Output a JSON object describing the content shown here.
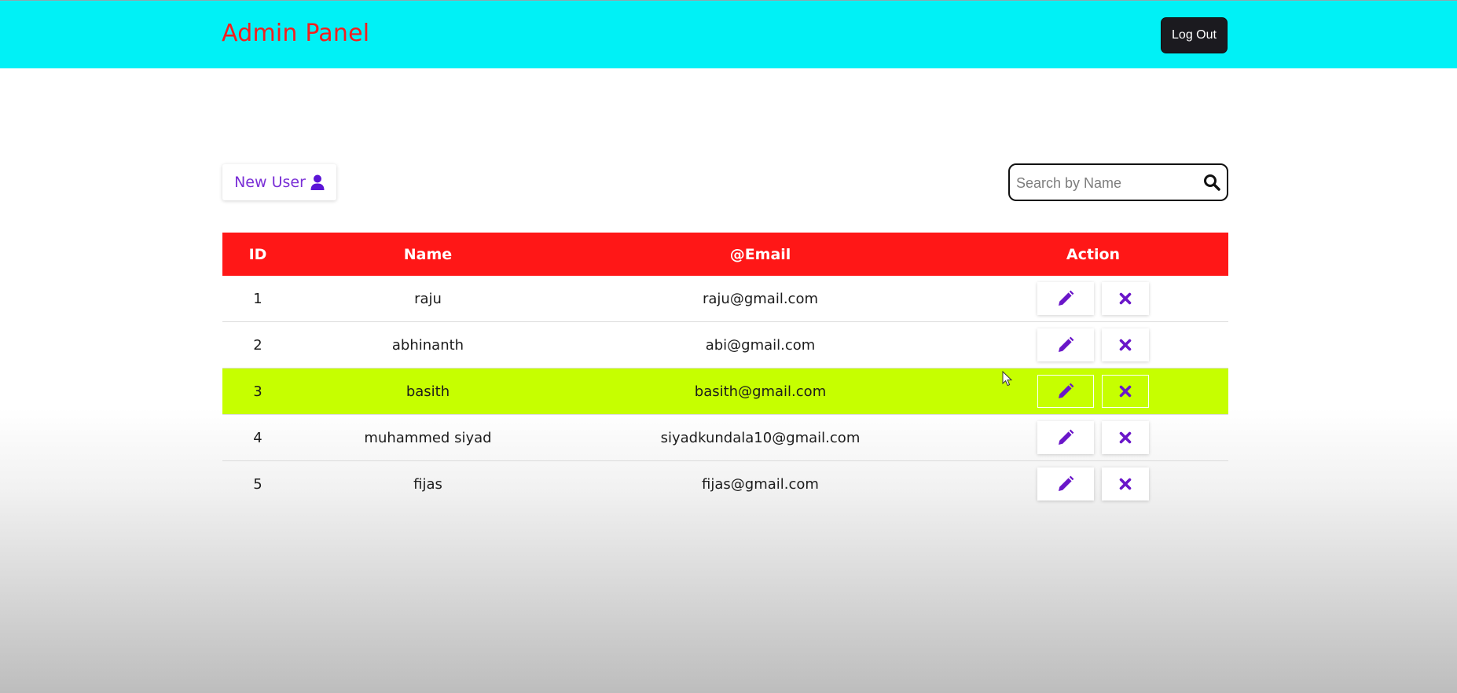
{
  "header": {
    "title": "Admin Panel",
    "logout_label": "Log Out",
    "background_color": "#00f1f6",
    "title_color": "#f71d1d"
  },
  "toolbar": {
    "new_user_label": "New User",
    "new_user_icon": "user-icon",
    "search_placeholder": "Search by Name",
    "search_value": "",
    "search_icon": "search-icon"
  },
  "table": {
    "header_color": "#ff1717",
    "highlight_color": "#c6ff00",
    "columns": [
      "ID",
      "Name",
      "@Email",
      "Action"
    ],
    "rows": [
      {
        "id": "1",
        "name": "raju",
        "email": "raju@gmail.com"
      },
      {
        "id": "2",
        "name": "abhinanth",
        "email": "abi@gmail.com"
      },
      {
        "id": "3",
        "name": "basith",
        "email": "basith@gmail.com"
      },
      {
        "id": "4",
        "name": "muhammed siyad",
        "email": "siyadkundala10@gmail.com"
      },
      {
        "id": "5",
        "name": "fijas",
        "email": "fijas@gmail.com"
      }
    ],
    "action_icons": [
      "pencil-icon",
      "close-icon"
    ],
    "icon_color": "#6a16c9"
  }
}
